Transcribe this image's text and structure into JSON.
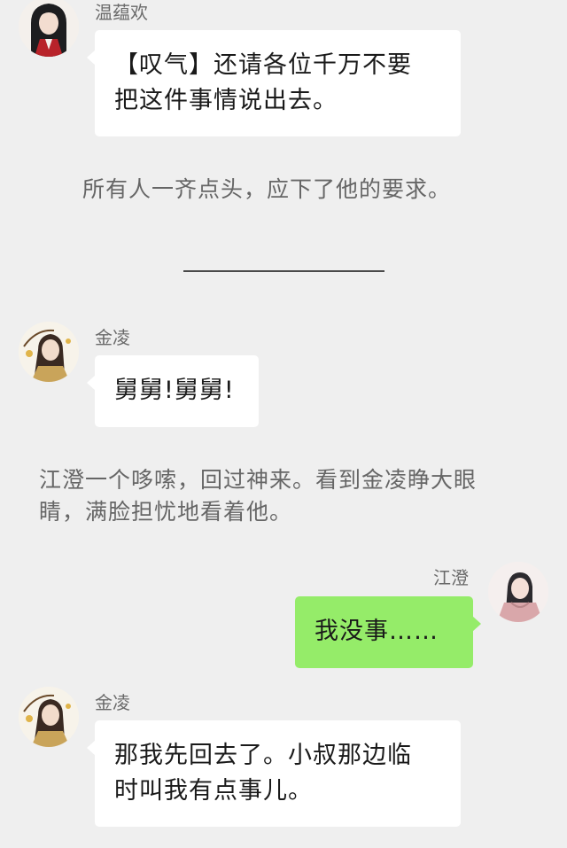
{
  "messages": [
    {
      "sender": "温蕴欢",
      "text_lines": [
        "【叹气】还请各位千万不要",
        "把这件事情说出去。"
      ],
      "avatar_icon": "dark-haired-character-avatar"
    },
    {
      "sender": "金凌",
      "text_lines": [
        "舅舅!舅舅!"
      ],
      "avatar_icon": "golden-robed-character-avatar"
    },
    {
      "sender": "江澄",
      "text_lines": [
        "我没事……"
      ],
      "avatar_icon": "pink-robed-character-avatar"
    },
    {
      "sender": "金凌",
      "text_lines": [
        "那我先回去了。小叔那边临",
        "时叫我有点事儿。"
      ],
      "avatar_icon": "golden-robed-character-avatar"
    }
  ],
  "narrations": [
    {
      "lines": [
        "所有人一齐点头，应下了他的要求。"
      ]
    },
    {
      "lines": [
        "江澄一个哆嗦，回过神来。看到金凌睁大眼",
        "睛，满脸担忧地看着他。"
      ]
    }
  ],
  "colors": {
    "background": "#efefef",
    "incoming_bubble": "#ffffff",
    "outgoing_bubble": "#95ec69"
  }
}
